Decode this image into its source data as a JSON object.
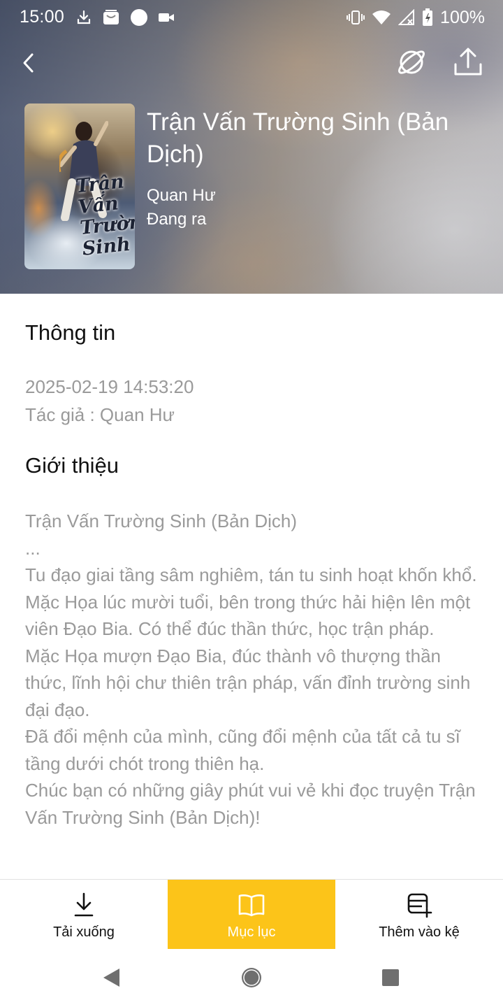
{
  "status_bar": {
    "time": "15:00",
    "battery_percent": "100%",
    "left_icons": [
      "download-icon",
      "inbox-icon",
      "circle-icon",
      "video-camera-icon"
    ],
    "right_icons": [
      "vibrate-icon",
      "wifi-icon",
      "signal-icon",
      "battery-icon"
    ]
  },
  "header": {
    "back_icon": "chevron-left-icon",
    "planet_icon": "planet-icon",
    "share_icon": "share-icon"
  },
  "book": {
    "title": "Trận Vấn Trường Sinh (Bản Dịch)",
    "author": "Quan Hư",
    "status": "Đang ra",
    "cover_art_text": "Trận Vấn Trường Sinh"
  },
  "info": {
    "heading": "Thông tin",
    "date": "2025-02-19 14:53:20",
    "author_line": "Tác giả : Quan Hư"
  },
  "intro": {
    "heading": "Giới thiệu",
    "lines": [
      "Trận Vấn Trường Sinh (Bản Dịch)",
      "...",
      "Tu đạo giai tầng sâm nghiêm, tán tu sinh hoạt khốn khổ.",
      "Mặc Họa lúc mười tuổi, bên trong thức hải hiện lên một viên Đạo Bia. Có thể đúc thần thức, học trận pháp.",
      "Mặc Họa mượn Đạo Bia, đúc thành vô thượng thần thức, lĩnh hội chư thiên trận pháp, vấn đỉnh trường sinh đại đạo.",
      "Đã đổi mệnh của mình, cũng đổi mệnh của tất cả tu sĩ tầng dưới chót trong thiên hạ.",
      "Chúc bạn có những giây phút vui vẻ khi đọc truyện Trận Vấn Trường Sinh (Bản Dịch)!"
    ]
  },
  "bottom_bar": {
    "download_label": "Tải xuống",
    "toc_label": "Mục lục",
    "add_shelf_label": "Thêm vào kệ",
    "active_color": "#fcc419"
  },
  "system_nav": {
    "back_icon": "triangle-back-icon",
    "home_icon": "circle-home-icon",
    "recent_icon": "square-recent-icon"
  }
}
